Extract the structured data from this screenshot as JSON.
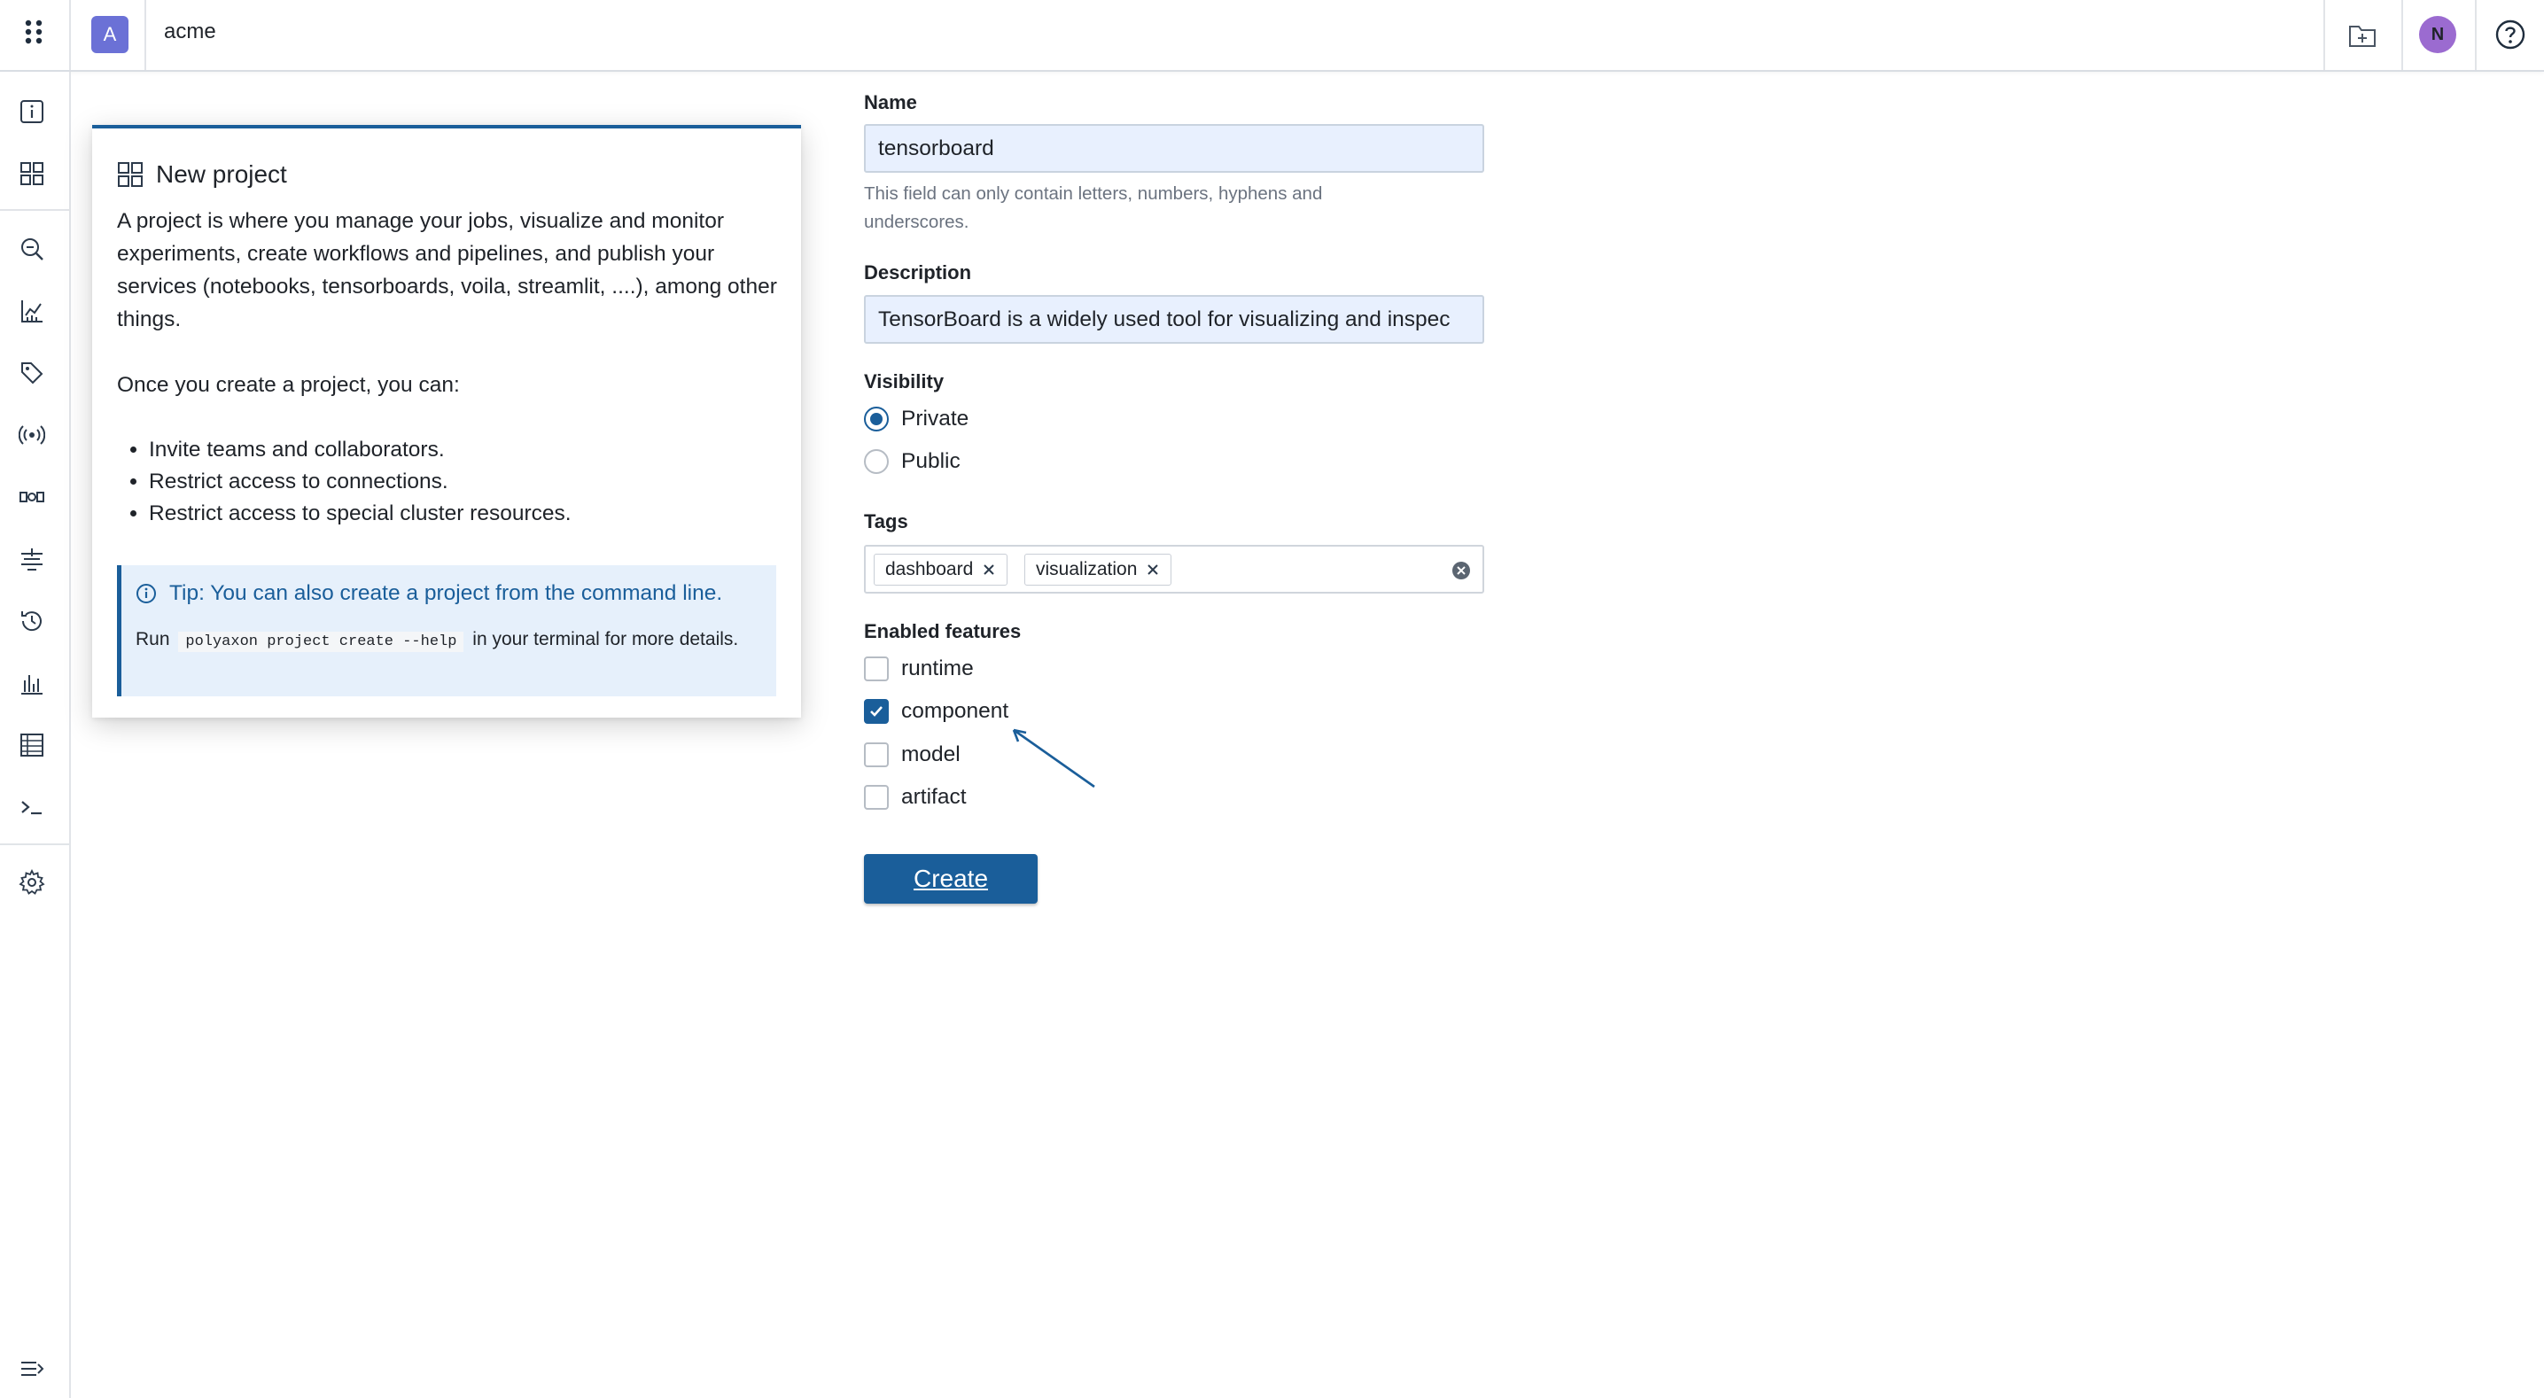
{
  "topbar": {
    "org_initial": "A",
    "org_name": "acme",
    "user_initial": "N"
  },
  "sidebar": {
    "items": [
      {
        "icon": "info-icon"
      },
      {
        "icon": "dashboard-grid-icon"
      },
      {
        "icon": "search-runs-icon"
      },
      {
        "icon": "analytics-chart-icon"
      },
      {
        "icon": "tag-icon"
      },
      {
        "icon": "broadcast-icon"
      },
      {
        "icon": "pipeline-icon"
      },
      {
        "icon": "filter-lines-icon"
      },
      {
        "icon": "history-clock-icon"
      },
      {
        "icon": "bar-chart-icon"
      },
      {
        "icon": "table-list-icon"
      },
      {
        "icon": "terminal-icon"
      },
      {
        "icon": "settings-gear-icon"
      },
      {
        "icon": "collapse-sidebar-icon"
      }
    ]
  },
  "info_card": {
    "title": "New project",
    "intro": "A project is where you manage your jobs, visualize and monitor experiments, create workflows and pipelines, and publish your services (notebooks, tensorboards, voila, streamlit, ....), among other things.",
    "once_created": "Once you create a project, you can:",
    "bullets": [
      "Invite teams and collaborators.",
      "Restrict access to connections.",
      "Restrict access to special cluster resources."
    ],
    "tip": {
      "title": "Tip: You can also create a project from the command line.",
      "run_prefix": "Run",
      "command": "polyaxon project create --help",
      "run_suffix": "in your terminal for more details."
    }
  },
  "form": {
    "name_label": "Name",
    "name_value": "tensorboard",
    "name_help": "This field can only contain letters, numbers, hyphens and underscores.",
    "description_label": "Description",
    "description_value": "TensorBoard is a widely used tool for visualizing and inspec",
    "visibility_label": "Visibility",
    "visibility_options": [
      {
        "label": "Private",
        "checked": true
      },
      {
        "label": "Public",
        "checked": false
      }
    ],
    "tags_label": "Tags",
    "tags": [
      "dashboard",
      "visualization"
    ],
    "features_label": "Enabled features",
    "features": [
      {
        "label": "runtime",
        "checked": false
      },
      {
        "label": "component",
        "checked": true
      },
      {
        "label": "model",
        "checked": false
      },
      {
        "label": "artifact",
        "checked": false
      }
    ],
    "create_label": "Create"
  },
  "colors": {
    "primary": "#1a5e9a",
    "org_badge": "#6b71d6",
    "avatar": "#9b6bd0",
    "input_bg": "#e8f0fe",
    "tip_bg": "#e6f0fb"
  }
}
